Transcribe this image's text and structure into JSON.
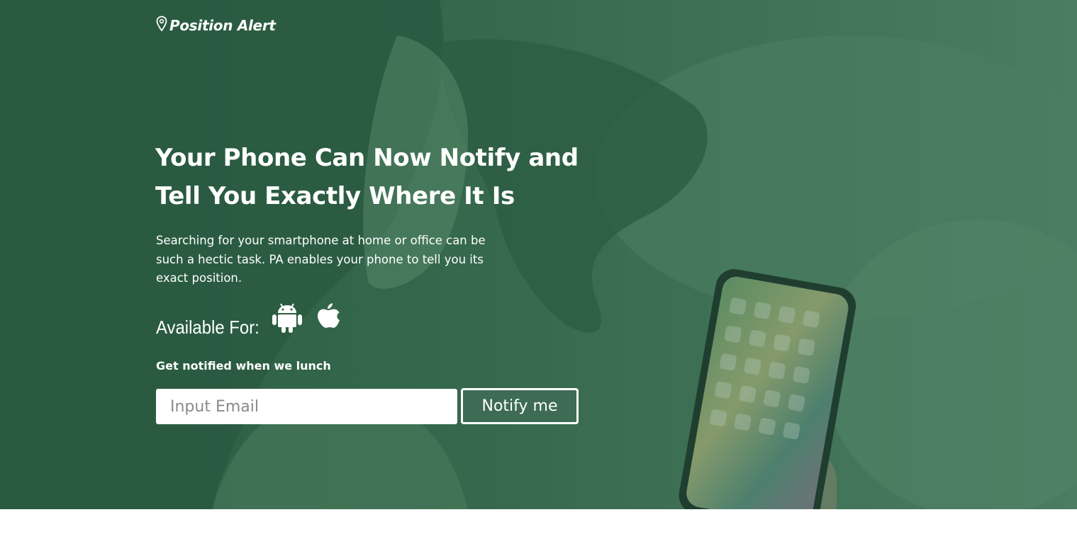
{
  "brand": {
    "name": "Position Alert",
    "logo_icon": "location-pin-icon"
  },
  "hero": {
    "headline": "Your Phone Can Now Notify and Tell You Exactly Where It Is",
    "description": "Searching for your smartphone at home or office can be such a hectic task. PA enables your phone to tell you its exact position.",
    "available_label": "Available For:",
    "platforms": [
      {
        "name": "Android",
        "icon": "android-icon"
      },
      {
        "name": "Apple",
        "icon": "apple-icon"
      }
    ]
  },
  "signup": {
    "title": "Get notified when we lunch",
    "email_placeholder": "Input Email",
    "email_value": "",
    "button_label": "Notify me"
  },
  "colors": {
    "overlay_green": "#3f6e55",
    "button_background": "#3e6b54",
    "text": "#ffffff"
  }
}
